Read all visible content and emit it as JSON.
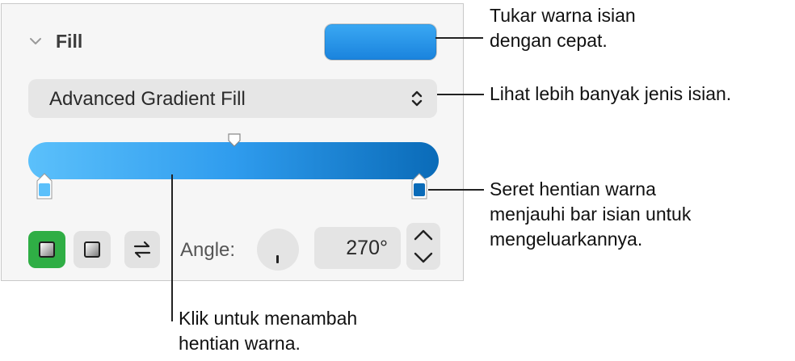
{
  "inspector": {
    "section_title": "Fill",
    "fill_color": "#2b97eb",
    "fill_type": "Advanced Gradient Fill",
    "gradient": {
      "start_color": "#5bc0fb",
      "end_color": "#0a6bb8",
      "stops": [
        {
          "color": "#5bc0fb"
        },
        {
          "color": "#0a6bb8"
        }
      ]
    },
    "gradient_types": [
      "linear",
      "radial"
    ],
    "selected_gradient_type": "linear",
    "angle_label": "Angle:",
    "angle_value": "270°",
    "icons": [
      "chevron-down-icon",
      "up-down-arrows-icon",
      "reverse-arrows-icon",
      "stepper-up-icon",
      "stepper-down-icon"
    ]
  },
  "callouts": {
    "swatch": [
      "Tukar warna isian",
      "dengan cepat."
    ],
    "fill_type": [
      "Lihat lebih banyak jenis isian."
    ],
    "stop": [
      "Seret hentian warna",
      "menjauhi bar isian untuk",
      "mengeluarkannya."
    ],
    "bar": [
      "Klik untuk menambah",
      "hentian warna."
    ]
  },
  "colors": {
    "selected_button": "#2fae45",
    "panel_background": "#f6f6f6"
  }
}
